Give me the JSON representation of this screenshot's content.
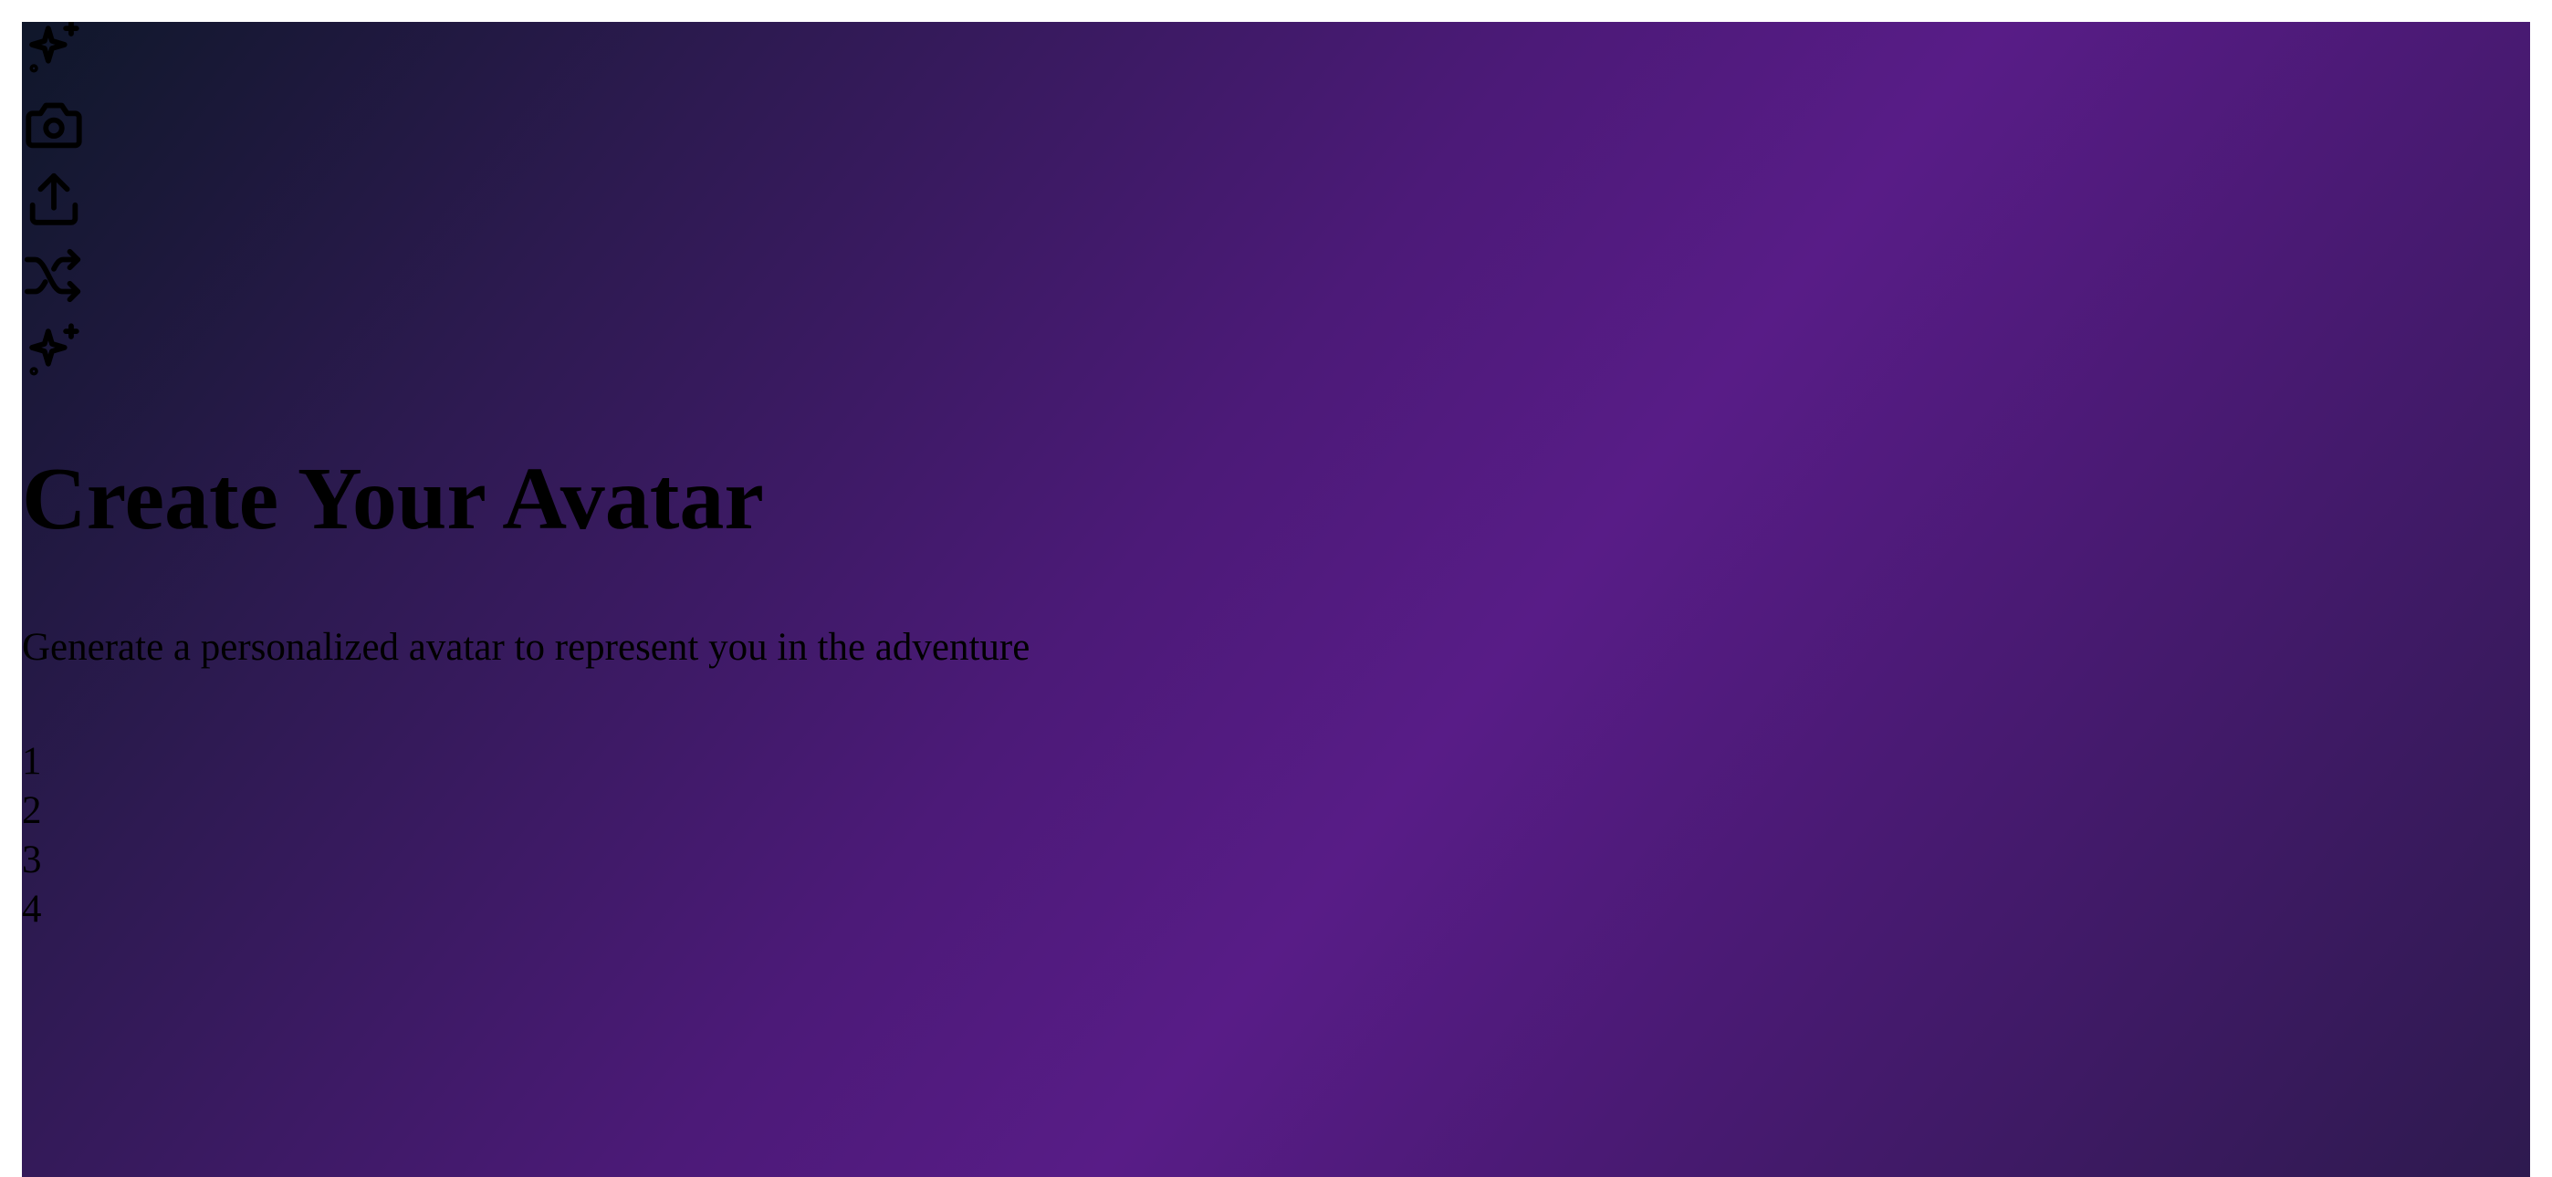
{
  "icons": [
    {
      "name": "sparkles-icon"
    },
    {
      "name": "camera-icon"
    },
    {
      "name": "upload-icon"
    },
    {
      "name": "shuffle-icon"
    },
    {
      "name": "sparkles-icon"
    }
  ],
  "page": {
    "title": "Create Your Avatar",
    "subtitle": "Generate a personalized avatar to represent you in the adventure"
  },
  "steps": [
    "1",
    "2",
    "3",
    "4"
  ],
  "colors": {
    "gradient_start": "#0f172a",
    "gradient_mid": "#581c87",
    "gradient_end": "#2e1a4f"
  }
}
